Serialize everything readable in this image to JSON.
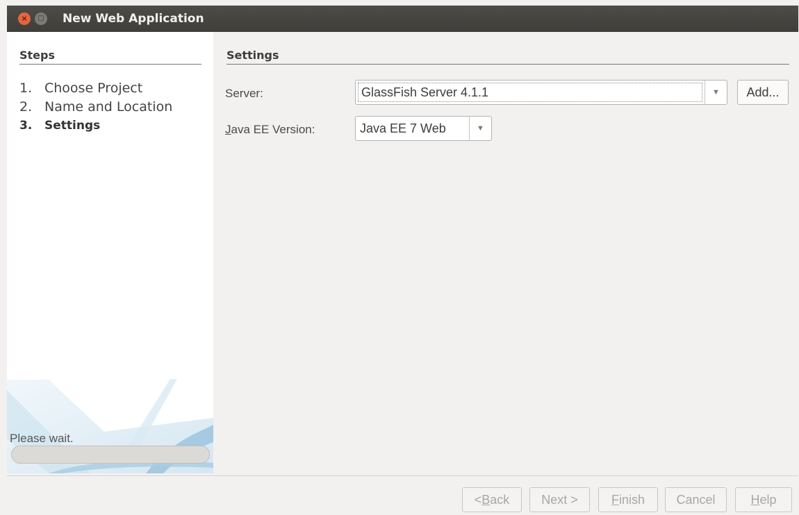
{
  "window": {
    "title": "New Web Application",
    "close_glyph": "×",
    "maximize_glyph": "□"
  },
  "steps": {
    "heading": "Steps",
    "items": [
      {
        "num": "1.",
        "label": "Choose Project"
      },
      {
        "num": "2.",
        "label": "Name and Location"
      },
      {
        "num": "3.",
        "label": "Settings",
        "current": true
      }
    ],
    "status_text": "Please wait.",
    "progress_fraction": 0.0
  },
  "settings": {
    "heading": "Settings",
    "server_label": "Server:",
    "server_value": "GlassFish Server 4.1.1",
    "add_button": "Add...",
    "javaee_label_mnemonic": "J",
    "javaee_label_rest": "ava EE Version:",
    "javaee_value": "Java EE 7 Web",
    "dropdown_glyph": "▼"
  },
  "footer": {
    "back_prefix": "< ",
    "back_mnemonic": "B",
    "back_rest": "ack",
    "next_label": "Next >",
    "finish_mnemonic": "F",
    "finish_rest": "inish",
    "cancel_label": "Cancel",
    "help_mnemonic": "H",
    "help_rest": "elp"
  },
  "colors": {
    "titlebar": "#3f3e3a",
    "close_button": "#e8643c",
    "panel_background": "#f2f1f0",
    "disabled_text": "#a9a7a4"
  }
}
